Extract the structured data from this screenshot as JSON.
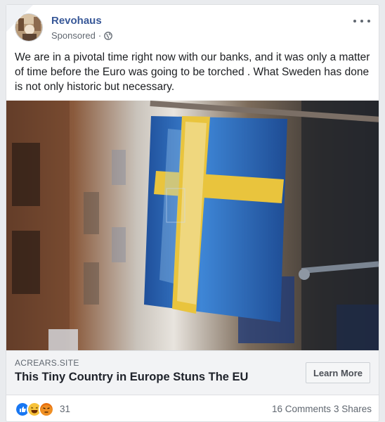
{
  "post": {
    "page_name": "Revohaus",
    "sponsored_label": "Sponsored",
    "meta_separator": "·",
    "text": "We are in a pivotal time right now with our banks, and it was only a matter of time before the Euro was going to be torched . What Sweden has done is not only historic but necessary."
  },
  "link_preview": {
    "domain": "ACREARS.SITE",
    "title": "This Tiny Country in Europe Stuns The EU",
    "cta_label": "Learn More"
  },
  "engagement": {
    "reaction_count": "31",
    "comments": "16 Comments",
    "shares": "3 Shares",
    "reactions": [
      "like-icon",
      "haha-icon",
      "angry-icon"
    ]
  },
  "colors": {
    "page_name": "#385898",
    "flag_blue": "#2f6fc4",
    "flag_yellow": "#e9c43d"
  }
}
